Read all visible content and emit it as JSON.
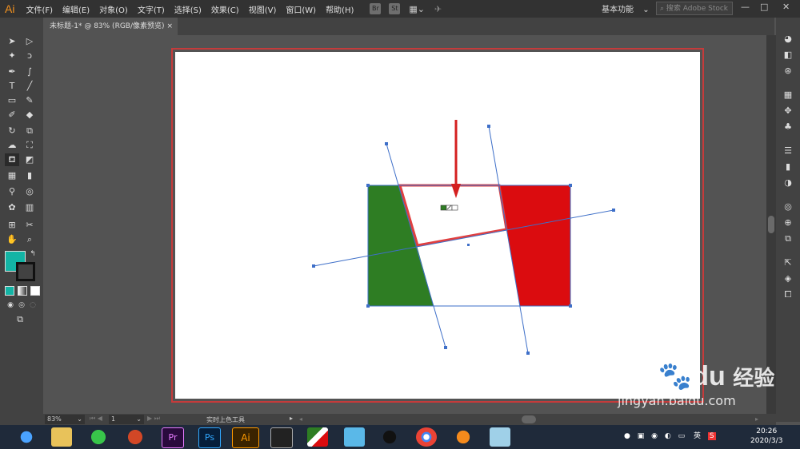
{
  "app": {
    "logo": "Ai"
  },
  "menu": [
    "文件(F)",
    "编辑(E)",
    "对象(O)",
    "文字(T)",
    "选择(S)",
    "效果(C)",
    "视图(V)",
    "窗口(W)",
    "帮助(H)"
  ],
  "toolbar_shortcuts": {
    "bridge": "Br",
    "stock": "St"
  },
  "workspace": {
    "label": "基本功能",
    "chevron": "⌄"
  },
  "search": {
    "placeholder": "搜索 Adobe Stock"
  },
  "window_controls": {
    "minimize": "—",
    "restore": "□",
    "close": "✕"
  },
  "document_tab": {
    "title": "未标题-1* @ 83% (RGB/像素预览)",
    "close": "×"
  },
  "status": {
    "zoom": "83%",
    "page": "1",
    "tool": "实时上色工具"
  },
  "colors": {
    "fill": "#13b4a5",
    "green": "#2e7d23",
    "red": "#db0c0f",
    "selection": "#3e6fc8",
    "highlight": "#e04040"
  },
  "tools": [
    "selection-tool",
    "direct-selection-tool",
    "magic-wand-tool",
    "lasso-tool",
    "pen-tool",
    "curvature-tool",
    "type-tool",
    "line-tool",
    "rectangle-tool",
    "paintbrush-tool",
    "shaper-tool",
    "eraser-tool",
    "rotate-tool",
    "scale-tool",
    "warp-tool",
    "free-transform-tool",
    "live-paint-bucket-tool",
    "perspective-tool",
    "mesh-tool",
    "gradient-tool",
    "eyedropper-tool",
    "blend-tool",
    "symbol-sprayer-tool",
    "graph-tool",
    "artboard-tool",
    "slice-tool",
    "hand-tool",
    "zoom-tool"
  ],
  "taskbar": {
    "apps": [
      "browser-icon",
      "explorer-icon",
      "wechat-icon",
      "powerpoint-icon",
      "premiere-icon",
      "photoshop-icon",
      "illustrator-icon",
      "media-icon",
      "vpn-icon",
      "cloud-icon",
      "qq-icon",
      "chrome-icon",
      "firefox-icon",
      "notes-icon"
    ],
    "premiere": "Pr",
    "photoshop": "Ps",
    "illustrator": "Ai"
  },
  "tray": {
    "ime": "英",
    "ime_s": "S"
  },
  "clock": {
    "time": "20:26",
    "date": "2020/3/3"
  },
  "watermark": {
    "brand": "Bai",
    "brand2": "du",
    "cn": "经验",
    "url": "jingyan.baidu.com"
  }
}
